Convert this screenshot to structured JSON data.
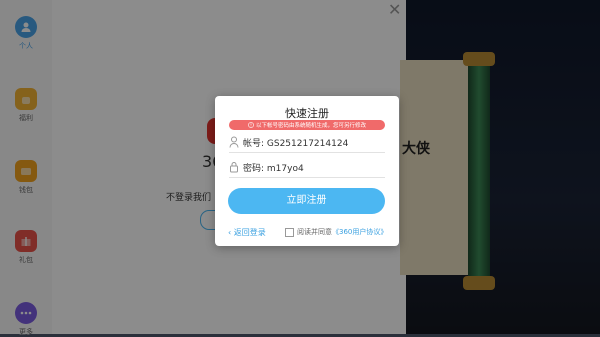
{
  "sidebar": {
    "items": [
      {
        "label": "个人",
        "icon": "user-icon",
        "color": "#4aa3e8"
      },
      {
        "label": "福利",
        "icon": "gift-bag-icon",
        "color": "#f2b233"
      },
      {
        "label": "钱包",
        "icon": "wallet-icon",
        "color": "#f2a21e"
      },
      {
        "label": "礼包",
        "icon": "gift-box-icon",
        "color": "#e9524a"
      },
      {
        "label": "更多",
        "icon": "more-icon",
        "color": "#7b5ce0"
      }
    ]
  },
  "background": {
    "logo_text": "36",
    "prompt_text": "不登录我们",
    "scroll_text": "大侠"
  },
  "dialog": {
    "title": "快速注册",
    "warning": "以下帐号密码由系统随机生成，您可另行修改",
    "account_label": "帐号: GS251217214124",
    "password_label": "密码: m17yo4",
    "register_button": "立即注册",
    "back_link": "返回登录",
    "agree_text": "阅读并同意",
    "agreement_link": "《360用户协议》"
  },
  "colors": {
    "accent": "#4cb7f2",
    "warning": "#f06a6a",
    "link": "#3aa0e0"
  }
}
